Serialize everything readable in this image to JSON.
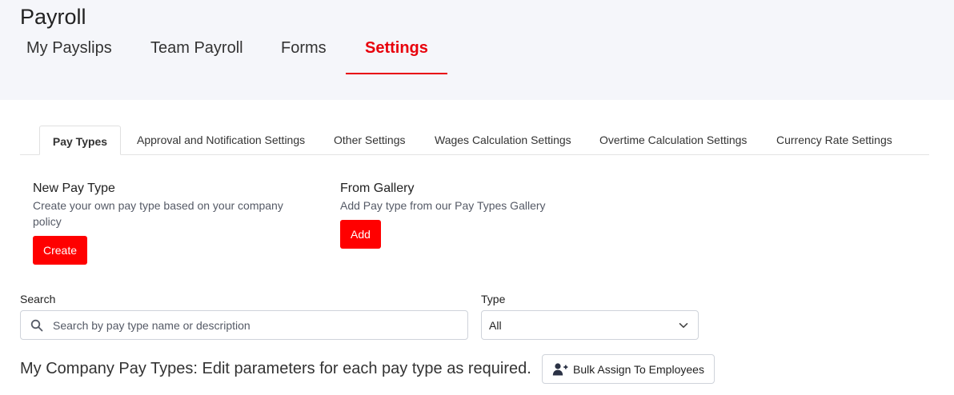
{
  "app": {
    "title": "Payroll"
  },
  "main_tabs": [
    {
      "label": "My Payslips"
    },
    {
      "label": "Team Payroll"
    },
    {
      "label": "Forms"
    },
    {
      "label": "Settings",
      "active": true
    }
  ],
  "sub_tabs": [
    {
      "label": "Pay Types",
      "active": true
    },
    {
      "label": "Approval and Notification Settings"
    },
    {
      "label": "Other Settings"
    },
    {
      "label": "Wages Calculation Settings"
    },
    {
      "label": "Overtime Calculation Settings"
    },
    {
      "label": "Currency Rate Settings"
    }
  ],
  "new_pay_type": {
    "title": "New Pay Type",
    "description": "Create your own pay type based on your company policy",
    "button": "Create"
  },
  "from_gallery": {
    "title": "From Gallery",
    "description": "Add Pay type from our Pay Types Gallery",
    "button": "Add"
  },
  "search": {
    "label": "Search",
    "placeholder": "Search by pay type name or description",
    "value": ""
  },
  "type_filter": {
    "label": "Type",
    "selected": "All"
  },
  "company_pay_types": {
    "title": "My Company Pay Types: Edit parameters for each pay type as required.",
    "bulk_button": "Bulk Assign To Employees"
  },
  "colors": {
    "accent": "#e8000b",
    "button_red": "#ff0000",
    "header_bg": "#f5f6fa"
  },
  "icons": {
    "search": "search-icon",
    "chevron": "chevron-down-icon",
    "bulk": "user-plus-icon"
  }
}
